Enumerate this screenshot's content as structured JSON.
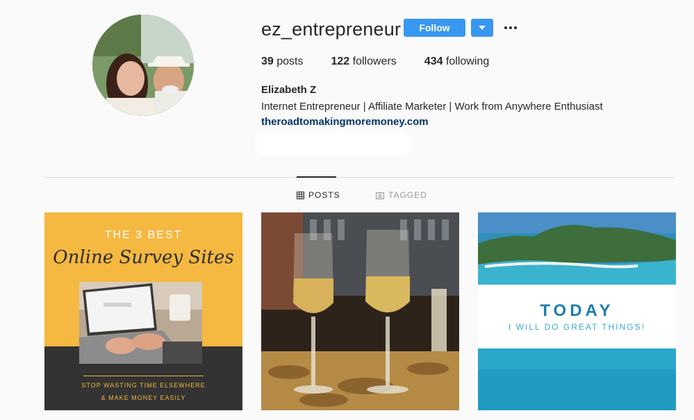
{
  "profile": {
    "username": "ez_entrepreneur",
    "follow_label": "Follow",
    "stats": {
      "posts_count": "39",
      "posts_label": "posts",
      "followers_count": "122",
      "followers_label": "followers",
      "following_count": "434",
      "following_label": "following"
    },
    "name": "Elizabeth Z",
    "bio": "Internet Entrepreneur | Affiliate Marketer | Work from Anywhere Enthusiast",
    "link": "theroadtomakingmoremoney.com"
  },
  "tabs": [
    {
      "label": "POSTS",
      "icon": "grid-icon",
      "active": true
    },
    {
      "label": "TAGGED",
      "icon": "tag-icon",
      "active": false
    }
  ],
  "posts": [
    {
      "top": "THE 3 BEST",
      "title": "Online Survey Sites",
      "bottom1": "STOP WASTING TIME ELSEWHERE",
      "bottom2": "& MAKE MONEY EASILY"
    },
    {},
    {
      "title": "TODAY",
      "subtitle": "I WILL DO GREAT THINGS!"
    }
  ],
  "colors": {
    "accent": "#3897f0",
    "link": "#003569",
    "post1_bg": "#f5b840"
  }
}
